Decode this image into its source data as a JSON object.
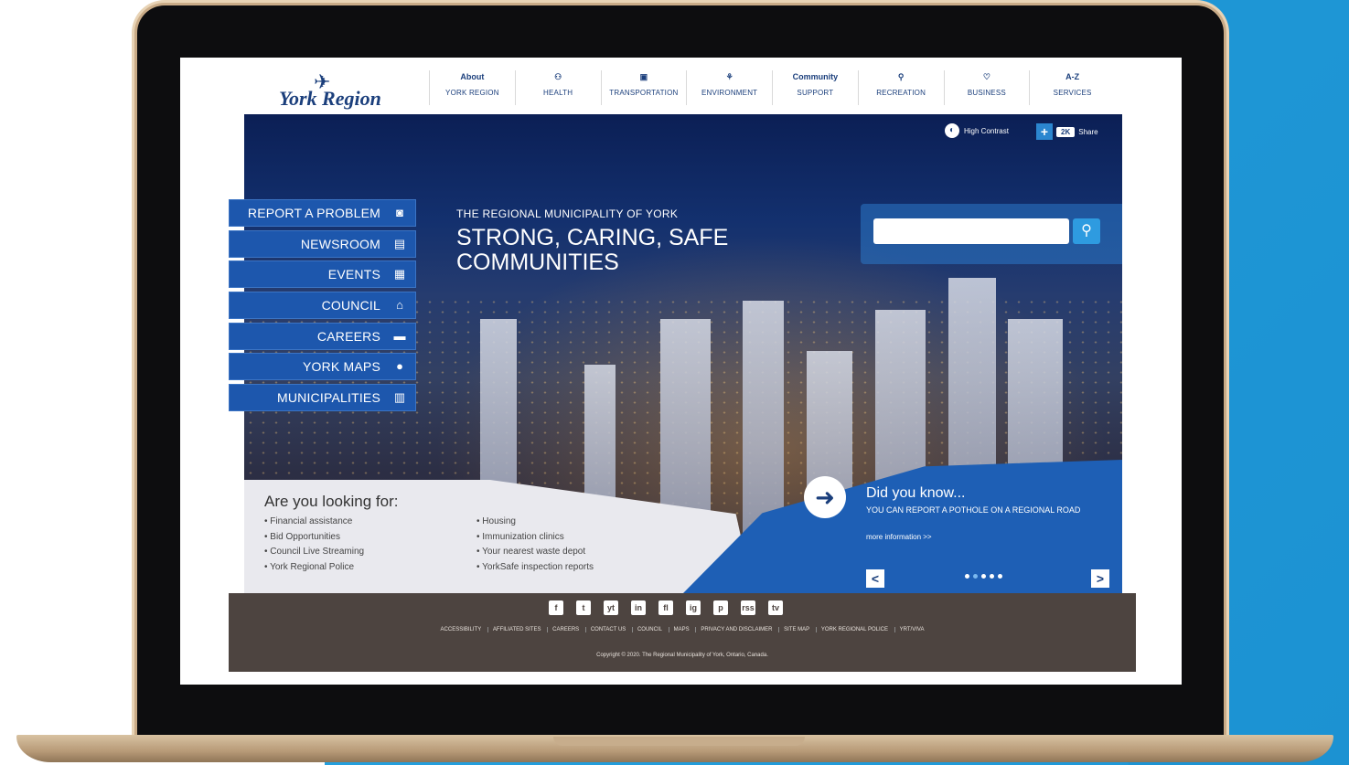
{
  "site": {
    "logo_text": "York Region"
  },
  "nav": [
    {
      "top": "About",
      "bottom": "YORK REGION",
      "icon": ""
    },
    {
      "top": "",
      "bottom": "HEALTH",
      "icon": "health-icon"
    },
    {
      "top": "",
      "bottom": "TRANSPORTATION",
      "icon": "transportation-icon"
    },
    {
      "top": "",
      "bottom": "ENVIRONMENT",
      "icon": "environment-icon"
    },
    {
      "top": "Community",
      "bottom": "SUPPORT",
      "icon": ""
    },
    {
      "top": "",
      "bottom": "RECREATION",
      "icon": "bicycle-icon"
    },
    {
      "top": "",
      "bottom": "BUSINESS",
      "icon": "handshake-icon"
    },
    {
      "top": "A-Z",
      "bottom": "SERVICES",
      "icon": ""
    }
  ],
  "utility": {
    "high_contrast": "High Contrast",
    "share_count": "2K",
    "share": "Share"
  },
  "hero": {
    "subtitle": "THE REGIONAL MUNICIPALITY OF YORK",
    "title": "STRONG, CARING, SAFE COMMUNITIES"
  },
  "search": {
    "placeholder": ""
  },
  "quick_links": [
    {
      "label": "REPORT A PROBLEM",
      "icon": "camera-icon"
    },
    {
      "label": "NEWSROOM",
      "icon": "newspaper-icon"
    },
    {
      "label": "EVENTS",
      "icon": "calendar-icon"
    },
    {
      "label": "COUNCIL",
      "icon": "building-icon"
    },
    {
      "label": "CAREERS",
      "icon": "briefcase-icon"
    },
    {
      "label": "YORK MAPS",
      "icon": "map-pin-icon"
    },
    {
      "label": "MUNICIPALITIES",
      "icon": "city-icon"
    }
  ],
  "looking_for": {
    "title": "Are you looking for:",
    "col1": [
      "Financial assistance",
      "Bid Opportunities",
      "Council Live Streaming",
      "York Regional Police"
    ],
    "col2": [
      "Housing",
      "Immunization clinics",
      "Your nearest waste depot",
      "YorkSafe inspection reports"
    ]
  },
  "did_you_know": {
    "title": "Did you know...",
    "text": "YOU CAN REPORT A POTHOLE ON A REGIONAL ROAD",
    "link": "more information >>",
    "prev": "<",
    "next": ">"
  },
  "footer": {
    "social": [
      "f",
      "t",
      "yt",
      "in",
      "fl",
      "ig",
      "p",
      "rss",
      "tv"
    ],
    "links": [
      "ACCESSIBILITY",
      "AFFILIATED SITES",
      "CAREERS",
      "CONTACT US",
      "COUNCIL",
      "MAPS",
      "PRIVACY AND DISCLAIMER",
      "SITE MAP",
      "YORK REGIONAL POLICE",
      "YRT/VIVA"
    ],
    "copyright": "Copyright © 2020. The Regional Municipality of York, Ontario, Canada."
  },
  "colors": {
    "brand_navy": "#1b3f7c",
    "quick_link_blue": "#1d57ad",
    "footer_brown": "#4d4440",
    "background_blue": "#2aa6e2"
  }
}
